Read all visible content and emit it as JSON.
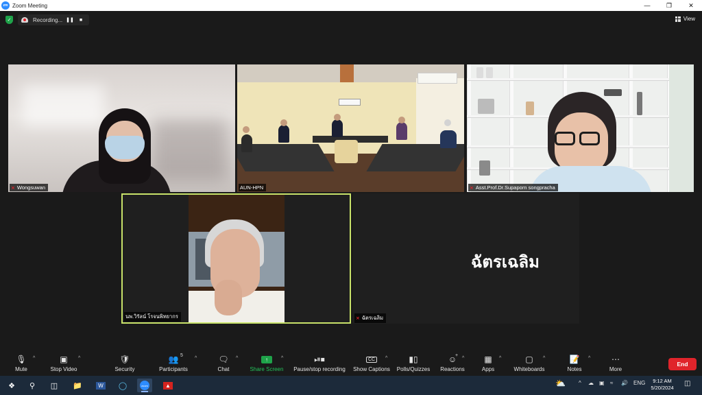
{
  "window": {
    "title": "Zoom Meeting"
  },
  "recording": {
    "label": "Recording..."
  },
  "view": {
    "label": "View"
  },
  "participants_tiles": [
    {
      "name": "Wongsuwan"
    },
    {
      "name": "AUN-HPN"
    },
    {
      "name": "Asst.Prof.Dr.Supaporn songpracha"
    },
    {
      "name": "นพ.วิรัลน์ โรจนพิทยากร"
    },
    {
      "name": "ฉัตรเฉลิม",
      "display_text": "ฉัตรเฉลิม"
    }
  ],
  "toolbar": {
    "mute": "Mute",
    "stop_video": "Stop Video",
    "security": "Security",
    "participants": "Participants",
    "participants_count": "5",
    "chat": "Chat",
    "share_screen": "Share Screen",
    "pause_recording": "Pause/stop recording",
    "show_captions": "Show Captions",
    "polls": "Polls/Quizzes",
    "reactions": "Reactions",
    "apps": "Apps",
    "whiteboards": "Whiteboards",
    "notes": "Notes",
    "more": "More",
    "end": "End",
    "cc_icon_text": "CC",
    "reactions_badge": "+"
  },
  "taskbar": {
    "time": "9:12 AM",
    "date": "5/20/2024",
    "lang": "ENG",
    "word_icon_text": "W",
    "zoom_icon_text": "zoom"
  },
  "colors": {
    "active_speaker_border": "#c9e36a",
    "end_button": "#e0242b",
    "share_green": "#1fa34a",
    "mic_off": "#e0242b"
  }
}
